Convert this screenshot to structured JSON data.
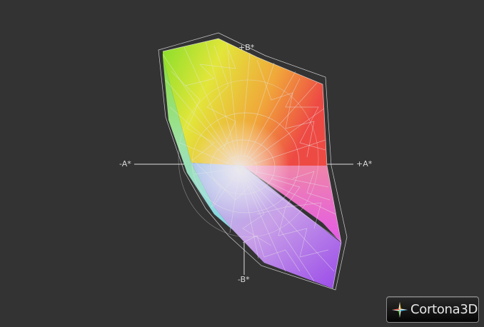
{
  "viewer": {
    "background": "#333333",
    "brand": "Cortona3D",
    "brand_icon": "cortona-star-icon"
  },
  "axes": {
    "pos_b": "+B*",
    "neg_a": "-A*",
    "pos_a": "+A*",
    "neg_b": "-B*"
  },
  "colors": {
    "green": "#7fdc28",
    "yellow": "#e6e61e",
    "orange": "#ec7a3a",
    "red": "#ee4a4a",
    "magenta": "#e65ae6",
    "violet": "#9a4ae6",
    "cyan": "#7fe0e0",
    "wire": "#e0e0e0",
    "axis": "#dddddd"
  }
}
